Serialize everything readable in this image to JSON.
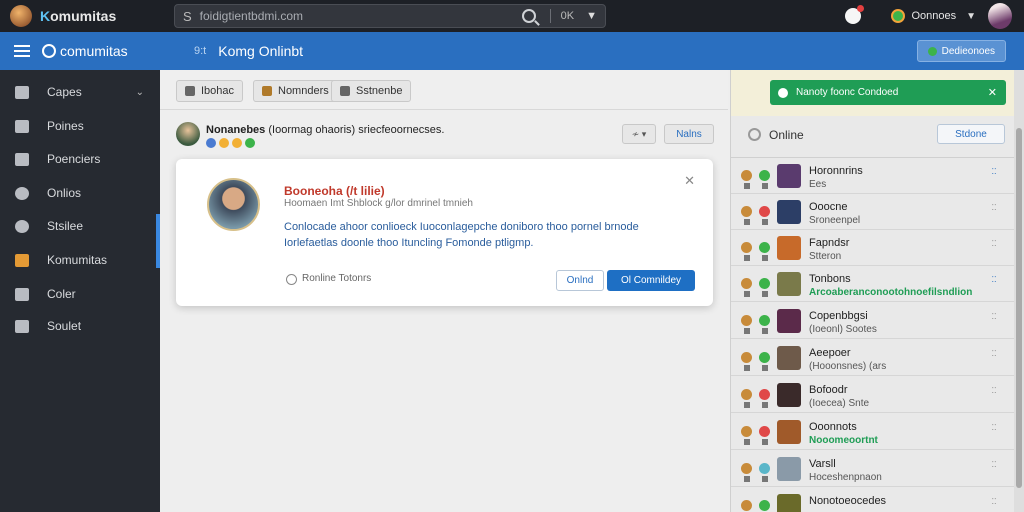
{
  "topbar": {
    "brand_k": "K",
    "brand_rest": "omumitas",
    "search_prefix": "S",
    "search_text": "foidigtientbdmi.com",
    "search_mode": "0K",
    "user_name": "Oonnoes"
  },
  "header": {
    "brand": "comumitas",
    "channel_hash": "9:t",
    "channel_name": "Komg Onlinbt",
    "action_label": "Dedieonoes"
  },
  "sidebar": {
    "items": [
      {
        "label": "Capes",
        "icon": "image-icon"
      },
      {
        "label": "Poines",
        "icon": "chart-icon"
      },
      {
        "label": "Poenciers",
        "icon": "people-icon"
      },
      {
        "label": "Onlios",
        "icon": "globe-icon"
      },
      {
        "label": "Stsilee",
        "icon": "clock-icon"
      },
      {
        "label": "Komumitas",
        "icon": "folder-icon"
      },
      {
        "label": "Coler",
        "icon": "palette-icon"
      },
      {
        "label": "Soulet",
        "icon": "user-plus-icon"
      }
    ]
  },
  "tabs": [
    {
      "label": "Ibohac"
    },
    {
      "label": "Nomnders"
    },
    {
      "label": "Sstnenbe"
    }
  ],
  "post": {
    "author": "Nonanebes",
    "meta": "(Ioormag ohaoris) sriecfeoornecses.",
    "actions_label": "≁ ▾",
    "link_label": "Nalns"
  },
  "dialog": {
    "title": "Booneoha (/t lilie)",
    "subtitle": "Hoomaen Imt Shblock g/lor dmrinel tmnieh",
    "body": "Conlocade ahoor conlioeck Iuoconlagepche doniboro thoo pornel brnode Iorlefaetlas doonle thoo Ituncling Fomonde ptligmp.",
    "footer_note": "Ronline Totonrs",
    "secondary_btn": "Onlnd",
    "primary_btn": "Ol Comnildey"
  },
  "right_panel": {
    "banner_text": "Nanoty foonc Condoed",
    "online_label": "Online",
    "online_btn": "Stdone",
    "members": [
      {
        "name": "Horonnrins",
        "sub": "Ees",
        "sub_green": false,
        "dot": "#3cb34a",
        "av": "#5a3b6e",
        "act": "blue"
      },
      {
        "name": "Ooocne",
        "sub": "Sroneenpel",
        "sub_green": false,
        "dot": "#e04848",
        "av": "#2c3e66",
        "act": "gray"
      },
      {
        "name": "Fapndsr",
        "sub": "Stteron",
        "sub_green": false,
        "dot": "#3cb34a",
        "av": "#c76a2a",
        "act": "gray"
      },
      {
        "name": "Tonbons",
        "sub": "Arcoaberanconootohnoefilsndlion",
        "sub_green": true,
        "dot": "#3cb34a",
        "av": "#7a7a4a",
        "act": "blue"
      },
      {
        "name": "Copenbbgsi",
        "sub": "(Ioeonl) Sootes",
        "sub_green": false,
        "dot": "#3cb34a",
        "av": "#5b2a4a",
        "act": "gray"
      },
      {
        "name": "Aeepoer",
        "sub": "(Hooonsnes) (ars",
        "sub_green": false,
        "dot": "#3cb34a",
        "av": "#6e5a4a",
        "act": "gray"
      },
      {
        "name": "Bofoodr",
        "sub": "(Ioecea) Snte",
        "sub_green": false,
        "dot": "#e04848",
        "av": "#3a2a2a",
        "act": "gray"
      },
      {
        "name": "Ooonnots",
        "sub": "Nooomeoortnt",
        "sub_green": true,
        "dot": "#e04848",
        "av": "#a05a2a",
        "act": "gray"
      },
      {
        "name": "Varsll",
        "sub": "Hoceshenpnaon",
        "sub_green": false,
        "dot": "#5ab6c9",
        "av": "#8a9aa8",
        "act": "gray"
      },
      {
        "name": "Nonotoeocedes",
        "sub": "",
        "sub_green": false,
        "dot": "#3cb34a",
        "av": "#6a6a2a",
        "act": "gray"
      }
    ]
  }
}
